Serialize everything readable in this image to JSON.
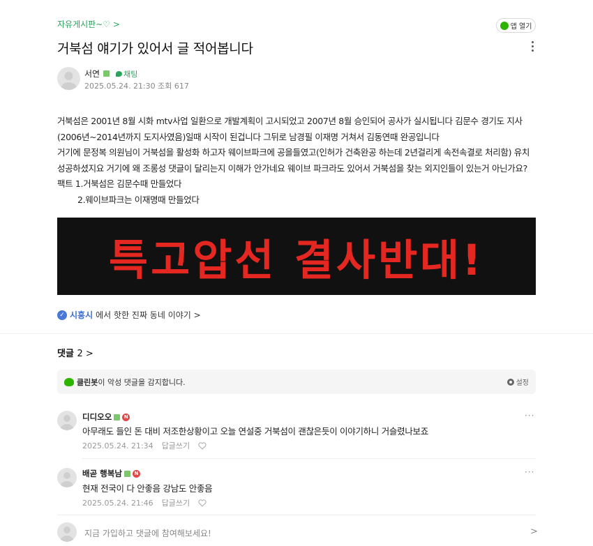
{
  "header": {
    "board_link": "자유게시판~♡ >",
    "app_button": "앱 열기"
  },
  "post": {
    "title": "거북섬 얘기가 있어서 글 적어봅니다",
    "author": "서연",
    "chat_label": "채팅",
    "meta": "2025.05.24. 21:30  조회 617",
    "body_lines": [
      "거북섬은 2001년  8월 시화 mtv사업 일환으로 개발계획이  고시되었고  2007년 8월 승인되어 공사가 실시됩니다 김문수 경기도 지사",
      "(2006년~2014년까지 도지사였음)일때 시작이 된겁니다  그뒤로 남경필 이재명 거쳐서 김동연때 완공입니다",
      "거기에 문정복 의원님이 거북섬을 활성화 하고자 웨이브파크에 공을들였고(인허가 건축완공 하는데 2년걸리게 속전속결로  처리함) 유치",
      "성공하셨지요 거기에  왜 조롱성 댓글이 달리는지 이해가 안가네요 웨이브 파크라도 있어서 거북섬을 찾는 외지인들이 있는거 아닌가요?",
      "팩트 1.거북섬은 김문수때 만들었다",
      "        2.웨이브파크는 이재명때 만들었다"
    ],
    "banner_text": "특고압선 결사반대!",
    "local_region": "시흥시",
    "local_suffix": "에서 핫한 진짜 동네 이야기 >"
  },
  "comments": {
    "header_label": "댓글",
    "count": "2 >",
    "cleanbot_name": "클린봇",
    "cleanbot_text": "이 악성 댓글을 감지합니다.",
    "settings_label": "설정",
    "items": [
      {
        "name": "디디오오",
        "text": "아무래도 들인 돈 대비 저조한상황이고 오늘 연설중 거북섬이 괜찮은듯이 이야기하니 거슬렸나보죠",
        "date": "2025.05.24. 21:34",
        "reply": "답글쓰기",
        "more": "···"
      },
      {
        "name": "배곧 행복남",
        "text": "현재 전국이 다 안좋음 강남도 안좋음",
        "date": "2025.05.24. 21:46",
        "reply": "답글쓰기",
        "more": "···"
      }
    ],
    "join_prompt": "지금 가입하고 댓글에 참여해보세요!",
    "join_arrow": ">"
  },
  "icons": {
    "app": "naver-cafe-icon",
    "more": "more-vertical-icon",
    "check": "verified-check-icon",
    "cleanbot": "cleanbot-icon",
    "settings": "gear-icon",
    "like": "heart-icon",
    "new_badge": "N"
  },
  "colors": {
    "accent_green": "#2aa35c",
    "banner_bg": "#111111",
    "banner_text": "#e42720",
    "region_blue": "#3c6fd1",
    "new_badge": "#e04848"
  }
}
